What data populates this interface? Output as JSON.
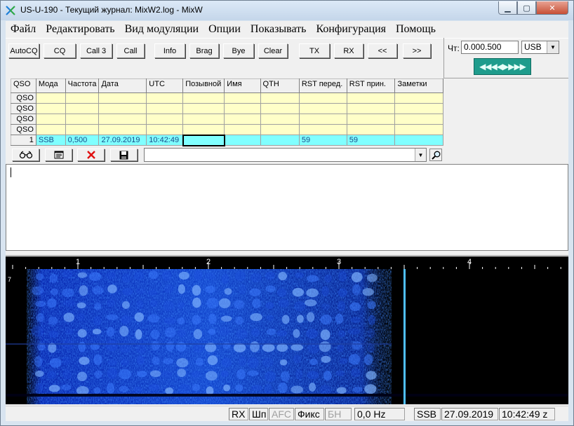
{
  "window": {
    "title": "US-U-190 - Текущий журнал: MixW2.log - MixW"
  },
  "menu": [
    "Файл",
    "Редактировать",
    "Вид модуляции",
    "Опции",
    "Показывать",
    "Конфигурация",
    "Помощь"
  ],
  "toolbar": {
    "buttons": [
      "AutoCQ",
      "CQ",
      "Call 3",
      "Call",
      "Info",
      "Brag",
      "Bye",
      "Clear",
      "TX",
      "RX",
      "<<",
      ">>"
    ]
  },
  "frequency": {
    "label": "Чт:",
    "value": "0.000.500",
    "mode": "USB",
    "tune_glyphs": "◀◀◀◀▶▶▶▶"
  },
  "log": {
    "columns": [
      "QSO",
      "Мода",
      "Частота",
      "Дата",
      "UTC",
      "Позывной",
      "Имя",
      "QTH",
      "RST перед.",
      "RST прин.",
      "Заметки"
    ],
    "empty_rows": [
      "QSO",
      "QSO",
      "QSO",
      "QSO"
    ],
    "current": {
      "num": "1",
      "mode": "SSB",
      "freq": "0,500",
      "date": "27.09.2019",
      "utc": "10:42:49",
      "call": "",
      "name": "",
      "qth": "",
      "rst_sent": "59",
      "rst_rcvd": "59",
      "notes": ""
    }
  },
  "log_tools": [
    "binoculars-icon",
    "notepad-icon",
    "delete-icon",
    "save-icon"
  ],
  "waterfall": {
    "scale_labels": [
      "1",
      "2",
      "3",
      "4"
    ],
    "marker_label": "7",
    "scale_kHz": [
      1,
      2,
      3,
      4
    ],
    "cursor_kHz": 3.5
  },
  "status": {
    "rx": "RX",
    "squelch": "Шп",
    "afc": "AFC",
    "fix": "Фикс",
    "bn": "БН",
    "offset": "0,0 Hz",
    "mode": "SSB",
    "date": "27.09.2019",
    "time": "10:42:49 z"
  }
}
